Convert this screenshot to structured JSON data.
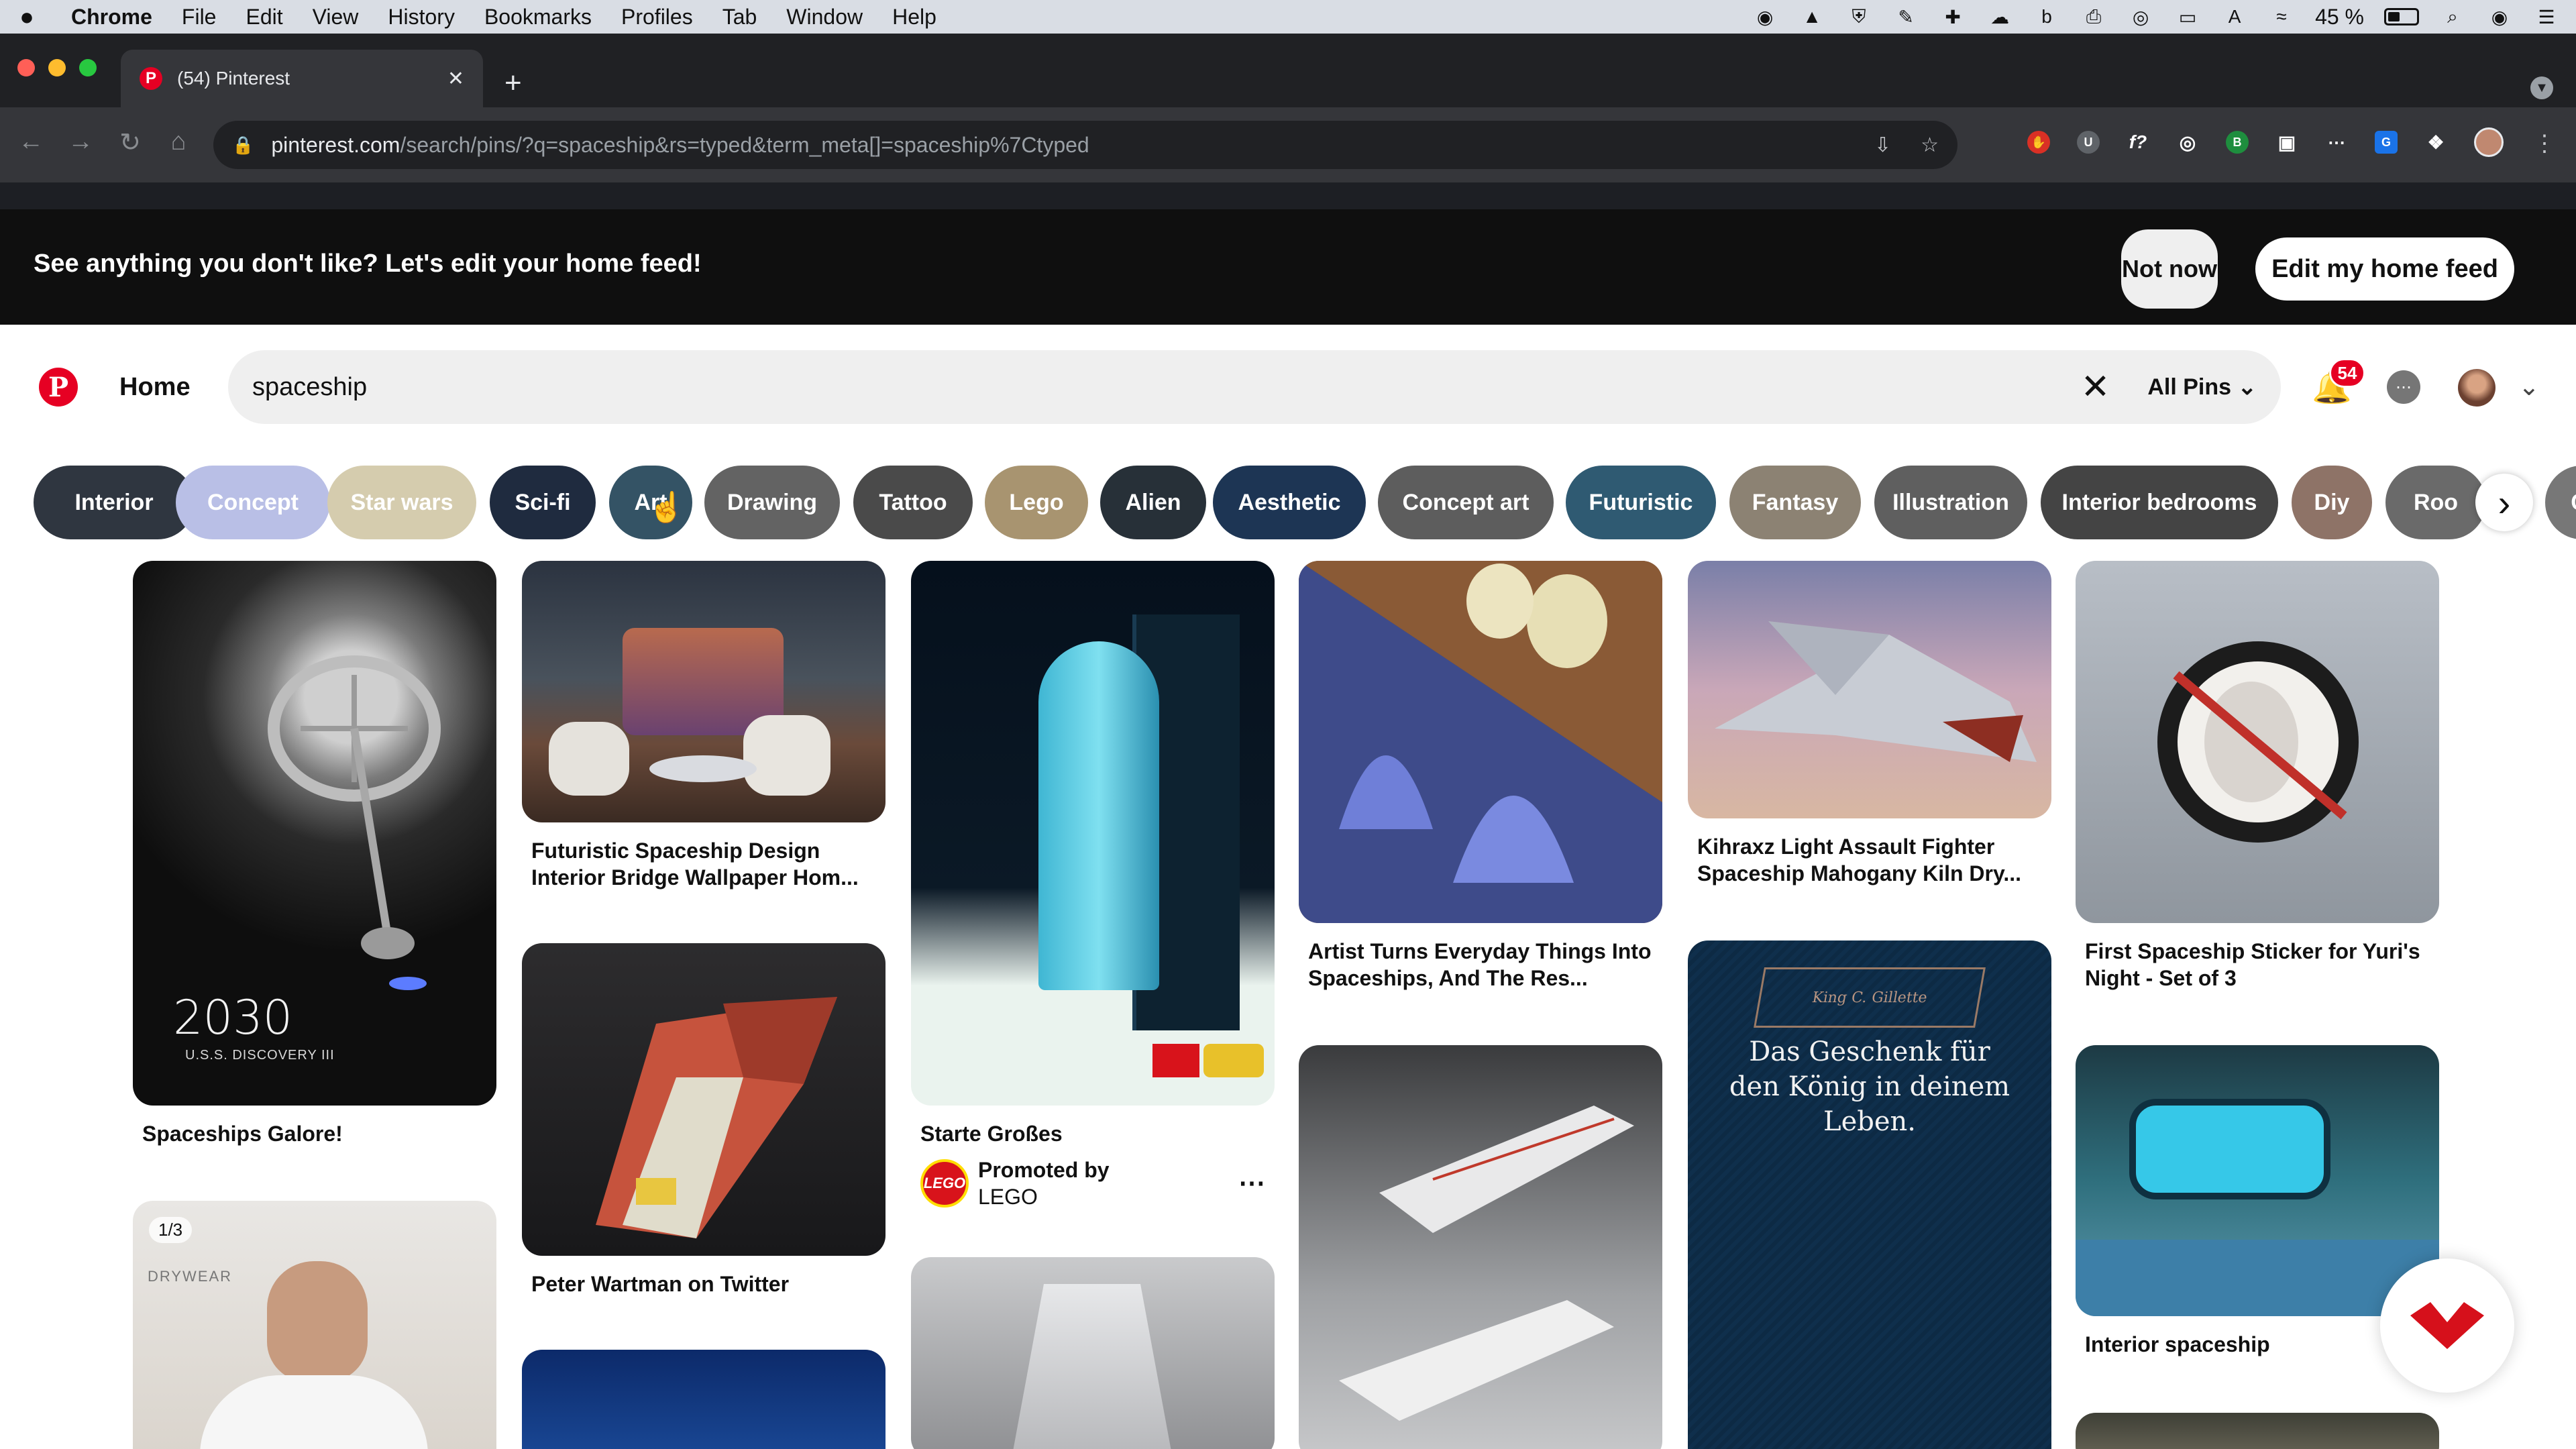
{
  "menubar": {
    "app": "Chrome",
    "items": [
      "File",
      "Edit",
      "View",
      "History",
      "Bookmarks",
      "Profiles",
      "Tab",
      "Window",
      "Help"
    ],
    "battery": "45 %"
  },
  "browser": {
    "tab_title": "(54) Pinterest",
    "url_host": "pinterest.com",
    "url_path": "/search/pins/?q=spaceship&rs=typed&term_meta[]=spaceship%7Ctyped"
  },
  "banner": {
    "message": "See anything you don't like? Let's edit your home feed!",
    "not_now": "Not now",
    "edit": "Edit my home feed"
  },
  "header": {
    "home": "Home",
    "search_value": "spaceship",
    "filter": "All Pins",
    "notifications": "54"
  },
  "chips": [
    {
      "label": "Interior",
      "color": "#2f3640"
    },
    {
      "label": "Concept",
      "color": "#b9bfe6"
    },
    {
      "label": "Star wars",
      "color": "#d5ccae"
    },
    {
      "label": "Sci-fi",
      "color": "#1f2b3f"
    },
    {
      "label": "Art",
      "color": "#345365"
    },
    {
      "label": "Drawing",
      "color": "#636363"
    },
    {
      "label": "Tattoo",
      "color": "#4a4a4a"
    },
    {
      "label": "Lego",
      "color": "#a89470"
    },
    {
      "label": "Alien",
      "color": "#273038"
    },
    {
      "label": "Aesthetic",
      "color": "#1d3554"
    },
    {
      "label": "Concept art",
      "color": "#5d5d5d"
    },
    {
      "label": "Futuristic",
      "color": "#2f5a72"
    },
    {
      "label": "Fantasy",
      "color": "#8c8273"
    },
    {
      "label": "Illustration",
      "color": "#5f5f5f"
    },
    {
      "label": "Interior bedrooms",
      "color": "#444444"
    },
    {
      "label": "Diy",
      "color": "#8e7367"
    },
    {
      "label": "Roo",
      "color": "#6a6a6a"
    },
    {
      "label": "Ca",
      "color": "#777777"
    }
  ],
  "pins": {
    "p1": {
      "title": "Spaceships Galore!",
      "overlay_year": "2030",
      "overlay_caption": "U.S.S. DISCOVERY III"
    },
    "p2": {
      "title": "Futuristic Spaceship Design Interior Bridge Wallpaper Hom..."
    },
    "p3": {
      "title": "Starte Großes",
      "promoted_by": "Promoted by",
      "advertiser": "LEGO",
      "logo_text": "LEGO"
    },
    "p4": {
      "title": "Artist Turns Everyday Things Into Spaceships, And The Res..."
    },
    "p5": {
      "title": "Kihraxz Light Assault Fighter Spaceship Mahogany Kiln Dry..."
    },
    "p6": {
      "title": "First Spaceship Sticker for Yuri's Night - Set of 3"
    },
    "p7": {
      "page_count": "1/3",
      "brand": "DRYWEAR"
    },
    "p8": {
      "title": "Peter Wartman on Twitter"
    },
    "p9": {
      "tagline": "Das Geschenk für den König in deinem Leben.",
      "brand": "King C. Gillette"
    },
    "p10": {
      "title": "Interior spaceship"
    }
  }
}
